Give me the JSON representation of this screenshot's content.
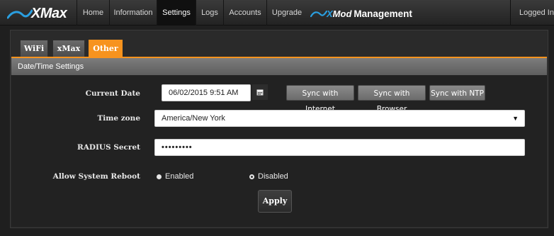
{
  "brand": {
    "name": "XMax",
    "icon": "xmax-swoosh-logo"
  },
  "nav": {
    "items": [
      {
        "label": "Home",
        "active": false
      },
      {
        "label": "Information",
        "active": false
      },
      {
        "label": "Settings",
        "active": true
      },
      {
        "label": "Logs",
        "active": false
      },
      {
        "label": "Accounts",
        "active": false
      },
      {
        "label": "Upgrade",
        "active": false
      }
    ],
    "product": {
      "prefix": "X",
      "name": "Mod",
      "suffix": "Management"
    },
    "user_menu": "Logged In"
  },
  "tabs": [
    {
      "label": "WiFi",
      "active": false
    },
    {
      "label": "xMax",
      "active": false
    },
    {
      "label": "Other",
      "active": true
    }
  ],
  "section": {
    "title": "Date/Time Settings"
  },
  "form": {
    "current_date": {
      "label": "Current Date",
      "value": "06/02/2015 9:51 AM"
    },
    "sync_buttons": [
      "Sync with Internet",
      "Sync with Browser",
      "Sync with NTP"
    ],
    "time_zone": {
      "label": "Time zone",
      "value": "America/New York"
    },
    "radius_secret": {
      "label": "RADIUS Secret",
      "value": "•••••••••"
    },
    "reboot": {
      "label": "Allow System Reboot",
      "options": [
        "Enabled",
        "Disabled"
      ],
      "selected": "Disabled"
    },
    "apply_label": "Apply"
  },
  "colors": {
    "accent": "#f7931e",
    "nav_bg": "#2a2a2a",
    "logo_blue": "#2a9fe0"
  }
}
